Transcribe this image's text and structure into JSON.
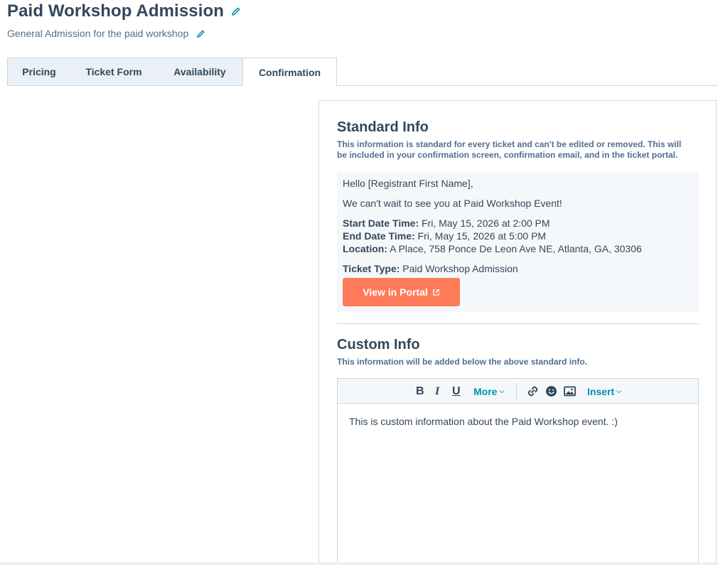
{
  "header": {
    "title": "Paid Workshop Admission",
    "subtitle": "General Admission for the paid workshop"
  },
  "tabs": [
    {
      "label": "Pricing",
      "active": false
    },
    {
      "label": "Ticket Form",
      "active": false
    },
    {
      "label": "Availability",
      "active": false
    },
    {
      "label": "Confirmation",
      "active": true
    }
  ],
  "standard_info": {
    "title": "Standard Info",
    "description_line1": "This information is standard for every ticket and can't be edited or removed. This will",
    "description_line2": "be included in your confirmation screen, confirmation email, and in the ticket portal.",
    "greeting": "Hello [Registrant First Name],",
    "message": "We can't wait to see you at Paid Workshop Event!",
    "start_label": "Start Date Time:",
    "start_value": "Fri, May 15, 2026 at 2:00 PM",
    "end_label": "End Date Time:",
    "end_value": "Fri, May 15, 2026 at 5:00 PM",
    "location_label": "Location:",
    "location_value": "A Place, 758 Ponce De Leon Ave NE, Atlanta, GA, 30306",
    "ticket_type_label": "Ticket Type:",
    "ticket_type_value": "Paid Workshop Admission",
    "portal_button": "View in Portal"
  },
  "custom_info": {
    "title": "Custom Info",
    "description": "This information will be added below the above standard info.",
    "toolbar": {
      "bold": "B",
      "italic": "I",
      "underline": "U",
      "more": "More",
      "insert": "Insert"
    },
    "content": "This is custom information about the Paid Workshop event. :)"
  },
  "colors": {
    "accent": "#ff7a59",
    "link": "#0091ae",
    "text": "#33475b",
    "border": "#cbd6e2"
  }
}
